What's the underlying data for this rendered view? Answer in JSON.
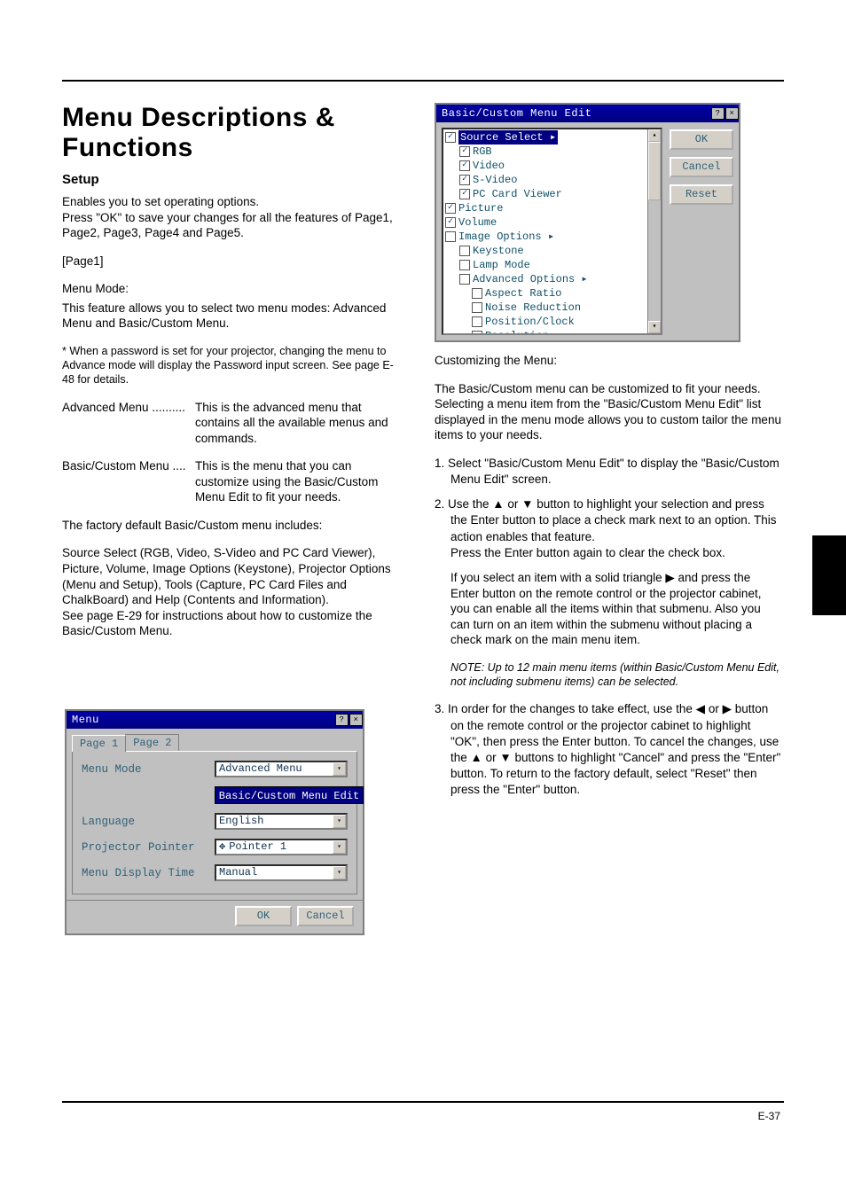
{
  "page_number": "E-37",
  "left": {
    "heading": "Menu Descriptions & Functions",
    "sub": "Setup",
    "para": "Enables you to set operating options.\nPress \"OK\" to save your changes for all the features of Page1, Page2, Page3, Page4 and Page5.",
    "page1_heading": "[Page1]",
    "menu_mode_heading": "Menu Mode:",
    "menu_mode_para": "This feature allows you to select two menu modes: Advanced Menu and Basic/Custom Menu.",
    "note": "* When a password is set for your projector, changing the menu to Advance mode will display the Password input screen. See page E-48 for details.",
    "adv_label": "Advanced Menu ..........",
    "adv_desc": "This is the advanced menu that contains all the available menus and commands.",
    "basic_label": "Basic/Custom Menu ....",
    "basic_desc": "This is the menu that you can customize using the Basic/Custom Menu Edit to fit your needs.",
    "factory_intro": "The factory default Basic/Custom menu includes:",
    "factory_list": "Source Select (RGB, Video, S-Video and PC Card Viewer), Picture, Volume, Image Options (Keystone), Projector Options (Menu and Setup), Tools (Capture, PC Card Files and ChalkBoard) and Help (Contents and Information).\nSee page E-29 for instructions about how to customize the Basic/Custom Menu."
  },
  "right": {
    "line1": "Customizing the Menu:",
    "line2": "The Basic/Custom menu can be customized to fit your needs. Selecting a menu item from the \"Basic/Custom Menu Edit\" list displayed in the menu mode allows you to custom tailor the menu items to your needs.",
    "step1": "1. Select \"Basic/Custom Menu Edit\" to display the \"Basic/Custom Menu Edit\" screen.",
    "step2": "2. Use the ▲ or ▼ button to highlight your selection and press the Enter button to place a check mark next to an option. This action enables that feature.\nPress the Enter button again to clear the check box.",
    "step2b": "If you select an item with a solid triangle ▶ and press the Enter button on the remote control or the projector cabinet, you can enable all the items within that submenu.\nAlso you can turn on an item within the submenu without placing a check mark on the main menu item.",
    "note2": "NOTE: Up to 12 main menu items (within Basic/Custom Menu Edit, not including submenu items) can be selected.",
    "step3": "3. In order for the changes to take effect, use the ◀ or ▶ button on the remote control or the projector cabinet to highlight \"OK\", then press the Enter button. To cancel the changes, use the ▲ or ▼ buttons to highlight \"Cancel\" and press the \"Enter\" button. To return to the factory default, select \"Reset\" then press the \"Enter\" button."
  },
  "bcme_dialog": {
    "title": "Basic/Custom Menu Edit",
    "buttons": {
      "ok": "OK",
      "cancel": "Cancel",
      "reset": "Reset"
    },
    "items": [
      {
        "label": "Source Select ▸",
        "checked": true,
        "indent": 0,
        "selected": true
      },
      {
        "label": "RGB",
        "checked": true,
        "indent": 1
      },
      {
        "label": "Video",
        "checked": true,
        "indent": 1
      },
      {
        "label": "S-Video",
        "checked": true,
        "indent": 1
      },
      {
        "label": "PC Card Viewer",
        "checked": true,
        "indent": 1
      },
      {
        "label": "Picture",
        "checked": true,
        "indent": 0
      },
      {
        "label": "Volume",
        "checked": true,
        "indent": 0
      },
      {
        "label": "Image Options ▸",
        "checked": false,
        "indent": 0
      },
      {
        "label": "Keystone",
        "checked": false,
        "indent": 1
      },
      {
        "label": "Lamp Mode",
        "checked": false,
        "indent": 1
      },
      {
        "label": "Advanced Options ▸",
        "checked": false,
        "indent": 1
      },
      {
        "label": "Aspect Ratio",
        "checked": false,
        "indent": 2
      },
      {
        "label": "Noise Reduction",
        "checked": false,
        "indent": 2
      },
      {
        "label": "Position/Clock",
        "checked": false,
        "indent": 2
      },
      {
        "label": "Resolution",
        "checked": false,
        "indent": 2
      }
    ]
  },
  "menu_dialog": {
    "title": "Menu",
    "tabs": {
      "p1": "Page 1",
      "p2": "Page 2"
    },
    "fields": {
      "menu_mode": {
        "label": "Menu Mode",
        "value": "Advanced Menu"
      },
      "edit_btn": "Basic/Custom Menu Edit",
      "language": {
        "label": "Language",
        "value": "English"
      },
      "pointer": {
        "label": "Projector Pointer",
        "value": "Pointer 1"
      },
      "display": {
        "label": "Menu Display Time",
        "value": "Manual"
      }
    },
    "footer": {
      "ok": "OK",
      "cancel": "Cancel"
    }
  }
}
